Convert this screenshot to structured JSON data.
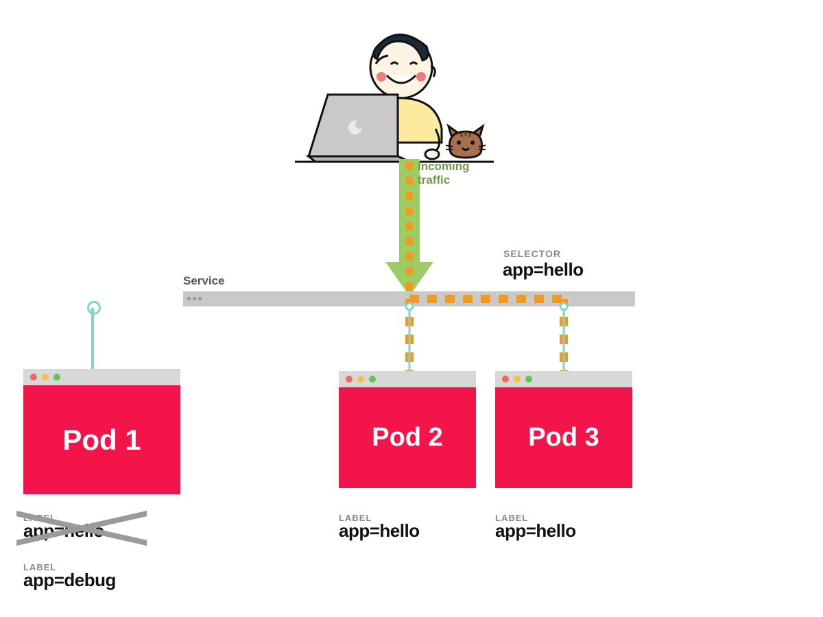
{
  "traffic_label": "Incoming\ntraffic",
  "service": {
    "title": "Service"
  },
  "selector": {
    "caption": "SELECTOR",
    "value": "app=hello"
  },
  "pods": {
    "p1": {
      "title": "Pod 1",
      "label_old": {
        "caption": "LABEL",
        "value": "app=hello"
      },
      "label_new": {
        "caption": "LABEL",
        "value": "app=debug"
      }
    },
    "p2": {
      "title": "Pod 2",
      "label": {
        "caption": "LABEL",
        "value": "app=hello"
      }
    },
    "p3": {
      "title": "Pod 3",
      "label": {
        "caption": "LABEL",
        "value": "app=hello"
      }
    }
  },
  "colors": {
    "pod_bg": "#f3154a",
    "service_bar": "#c9c9c9",
    "arrow_fill": "#8bc34a",
    "arrow_dash": "#f29a1f",
    "stem": "#7fd6c4",
    "traffic_text": "#6f9a47"
  }
}
